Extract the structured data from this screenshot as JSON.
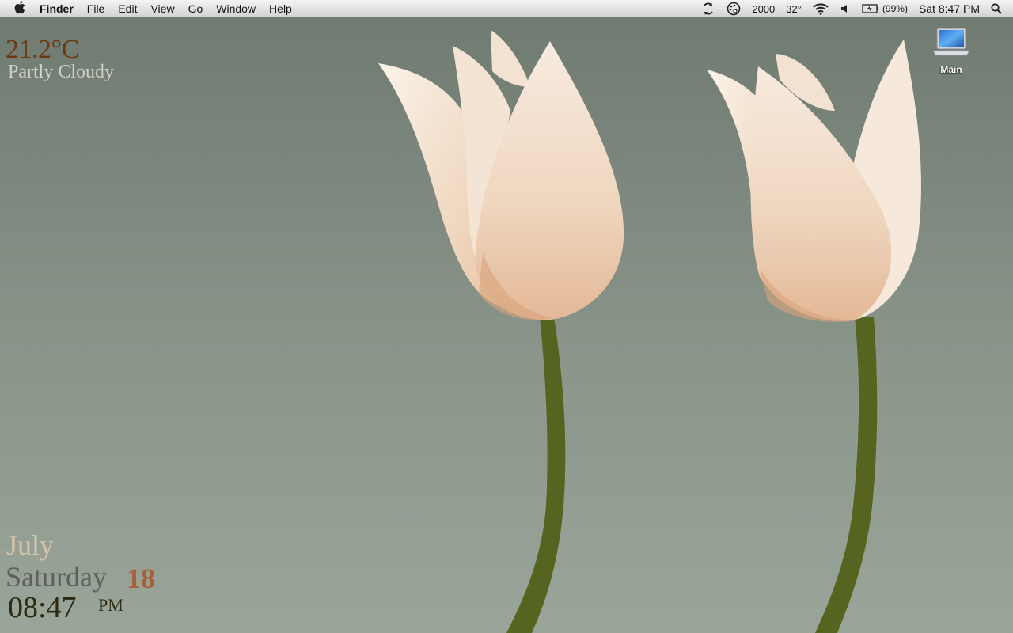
{
  "menubar": {
    "app_name": "Finder",
    "items": [
      "File",
      "Edit",
      "View",
      "Go",
      "Window",
      "Help"
    ],
    "status": {
      "count": "2000",
      "temperature": "32°",
      "battery": "(99%)",
      "clock": "Sat 8:47 PM"
    },
    "icons": [
      "apple-icon",
      "sync-icon",
      "palette-icon",
      "wifi-icon",
      "volume-icon",
      "battery-icon",
      "spotlight-icon"
    ]
  },
  "weather": {
    "temperature": "21.2°C",
    "condition": "Partly Cloudy"
  },
  "datetime": {
    "month": "July",
    "weekday": "Saturday",
    "day": "18",
    "time": "08:47",
    "ampm": "PM"
  },
  "desktop": {
    "icons": [
      {
        "label": "Main",
        "icon": "laptop-icon"
      }
    ]
  },
  "wallpaper": {
    "subject": "tulips-wallpaper",
    "colors": {
      "background": "#8c978c",
      "petal": "#f3dcc6",
      "stem": "#55641f"
    }
  }
}
